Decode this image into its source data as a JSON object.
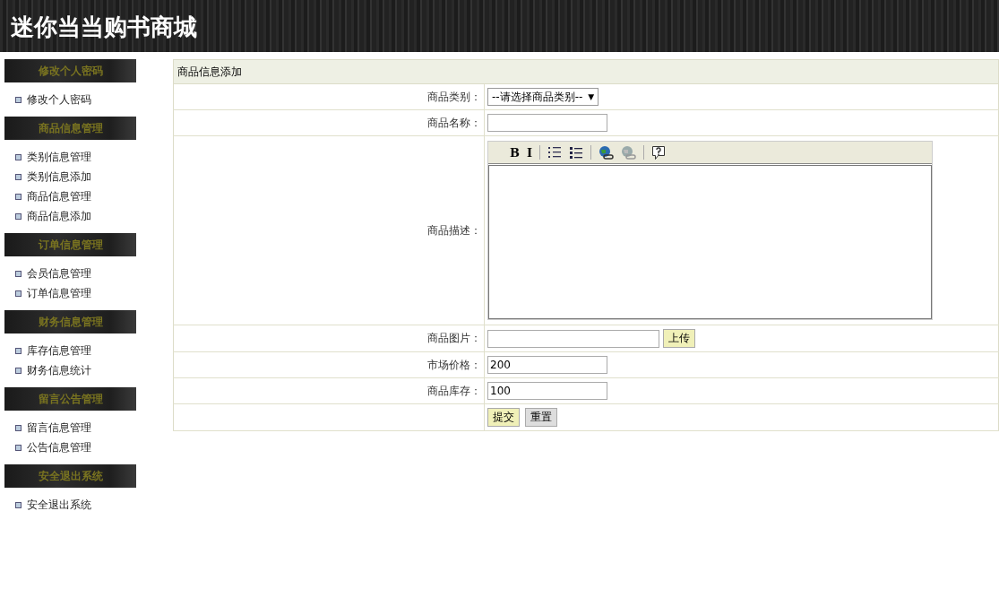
{
  "header": {
    "title": "迷你当当购书商城"
  },
  "sidebar": {
    "sections": [
      {
        "title": "修改个人密码",
        "items": [
          "修改个人密码"
        ]
      },
      {
        "title": "商品信息管理",
        "items": [
          "类别信息管理",
          "类别信息添加",
          "商品信息管理",
          "商品信息添加"
        ]
      },
      {
        "title": "订单信息管理",
        "items": [
          "会员信息管理",
          "订单信息管理"
        ]
      },
      {
        "title": "财务信息管理",
        "items": [
          "库存信息管理",
          "财务信息统计"
        ]
      },
      {
        "title": "留言公告管理",
        "items": [
          "留言信息管理",
          "公告信息管理"
        ]
      },
      {
        "title": "安全退出系统",
        "items": [
          "安全退出系统"
        ]
      }
    ]
  },
  "form": {
    "title": "商品信息添加",
    "rows": [
      {
        "kind": "select",
        "label": "商品类别：",
        "value": "--请选择商品类别--",
        "arrow": "▼"
      },
      {
        "kind": "text",
        "label": "商品名称："
      },
      {
        "kind": "editor",
        "label": "商品描述：",
        "toolbar": [
          {
            "kind": "bold",
            "text": "B"
          },
          {
            "kind": "italic",
            "text": "I"
          },
          {
            "kind": "ol"
          },
          {
            "kind": "ul"
          },
          {
            "kind": "link"
          },
          {
            "kind": "unlink"
          },
          {
            "kind": "help"
          }
        ]
      },
      {
        "kind": "file",
        "label": "商品图片：",
        "button": "上传"
      },
      {
        "kind": "text",
        "label": "市场价格：",
        "value": "200"
      },
      {
        "kind": "text",
        "label": "商品库存：",
        "value": "100"
      },
      {
        "kind": "buttons",
        "buttons": [
          "提交",
          "重置"
        ]
      }
    ]
  }
}
